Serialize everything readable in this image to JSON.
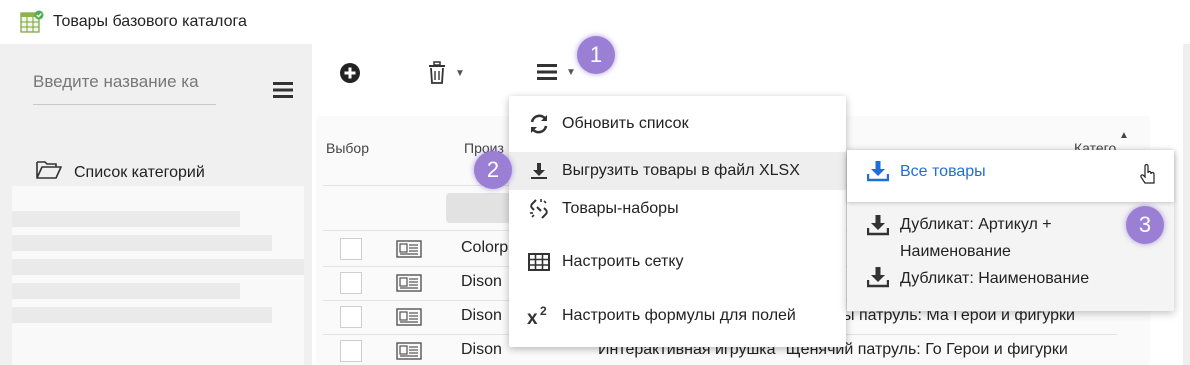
{
  "title": "Товары базового каталога",
  "left": {
    "search_placeholder": "Введите название ка",
    "folder_label": "Список категорий"
  },
  "grid": {
    "headers": {
      "select": "Выбор",
      "producer": "Произ",
      "category": "Катего"
    },
    "rows": [
      {
        "producer": "Colorpl",
        "name": ""
      },
      {
        "producer": "Dison",
        "name": ""
      },
      {
        "producer": "Dison",
        "name": "ы патруль: Ма Герои и фигурки"
      },
      {
        "producer": "Dison",
        "name": "Интерактивная игрушка \"Щенячий патруль: Го Герои и фигурки"
      }
    ]
  },
  "menu": {
    "items": [
      {
        "label": "Обновить список",
        "icon": "refresh-icon"
      },
      {
        "label": "Выгрузить товары в файл XLSX",
        "icon": "download-icon"
      },
      {
        "label": "Товары-наборы",
        "icon": "broken-link-icon"
      },
      {
        "label": "Настроить сетку",
        "icon": "grid-icon"
      },
      {
        "label": "Настроить формулы для полей",
        "icon": "superscript-icon"
      }
    ]
  },
  "submenu": {
    "items": [
      {
        "label": "Все товары",
        "icon": "download-icon"
      },
      {
        "label": "Дубликат: Артикул + Наименование",
        "icon": "download-icon"
      },
      {
        "label": "Дубликат: Наименование",
        "icon": "download-icon"
      }
    ]
  },
  "badges": [
    "1",
    "2",
    "3"
  ],
  "colors": {
    "accent": "#1e6fd9",
    "badge": "#9b7fd4"
  }
}
